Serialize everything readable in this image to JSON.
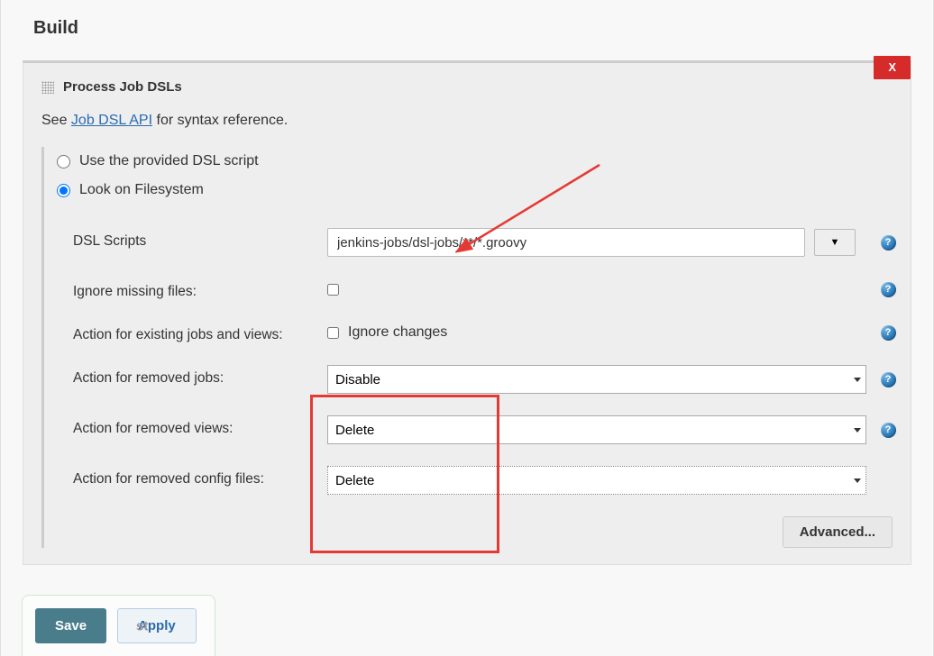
{
  "page_title": "Build",
  "section": {
    "close_label": "X",
    "title": "Process Job DSLs",
    "reference_prefix": "See ",
    "reference_link_text": "Job DSL API",
    "reference_suffix": " for syntax reference."
  },
  "radios": {
    "use_provided": "Use the provided DSL script",
    "look_filesystem": "Look on Filesystem"
  },
  "labels": {
    "dsl_scripts": "DSL Scripts",
    "ignore_missing": "Ignore missing files:",
    "action_existing": "Action for existing jobs and views:",
    "action_removed_jobs": "Action for removed jobs:",
    "action_removed_views": "Action for removed views:",
    "action_removed_config": "Action for removed config files:",
    "ignore_changes_checkbox": "Ignore changes"
  },
  "values": {
    "dsl_scripts": "jenkins-jobs/dsl-jobs/**/*.groovy",
    "expand_symbol": "▼",
    "removed_jobs": "Disable",
    "removed_views": "Delete",
    "removed_config": "Delete"
  },
  "buttons": {
    "advanced": "Advanced...",
    "save": "Save",
    "apply": "Apply"
  },
  "help": "?"
}
